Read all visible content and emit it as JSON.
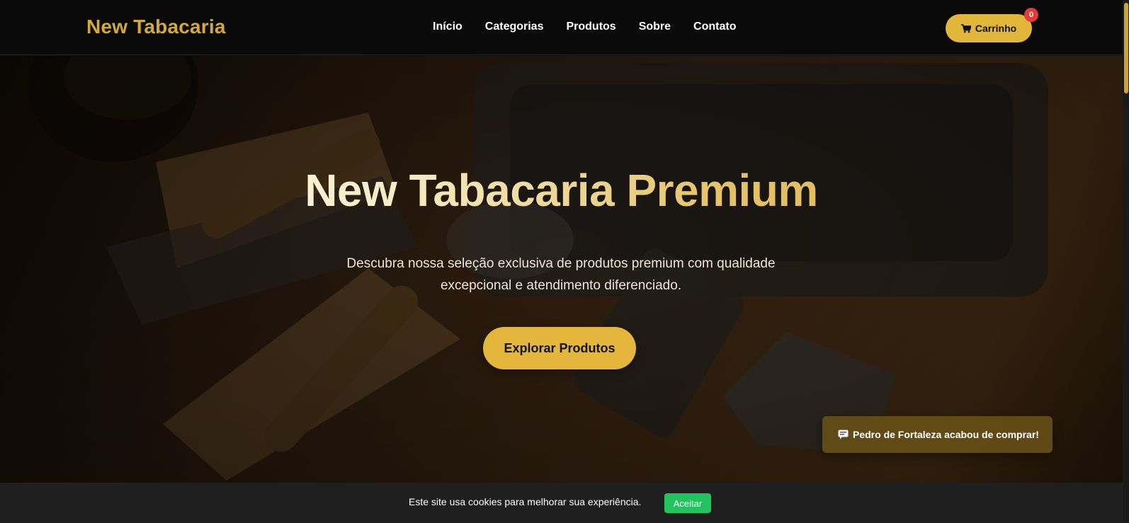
{
  "header": {
    "logo": "New Tabacaria",
    "nav": [
      {
        "label": "Início"
      },
      {
        "label": "Categorias"
      },
      {
        "label": "Produtos"
      },
      {
        "label": "Sobre"
      },
      {
        "label": "Contato"
      }
    ],
    "cart": {
      "label": "Carrinho",
      "count": "0",
      "icon": "cart-icon"
    }
  },
  "hero": {
    "title": "New Tabacaria Premium",
    "subtitle": "Descubra nossa seleção exclusiva de produtos premium com qualidade excepcional e atendimento diferenciado.",
    "button_label": "Explorar Produtos"
  },
  "toast": {
    "icon": "speech-bubble-icon",
    "text": "Pedro de Fortaleza acabou de comprar!"
  },
  "cookie": {
    "text": "Este site usa cookies para melhorar sua experiência.",
    "accept_label": "Aceitar"
  },
  "colors": {
    "accent": "#e2b63a",
    "header_bg": "#0a0a0a",
    "badge": "#e23b3b",
    "accept": "#22c35e",
    "cookie_bg": "#1f1f1f"
  }
}
